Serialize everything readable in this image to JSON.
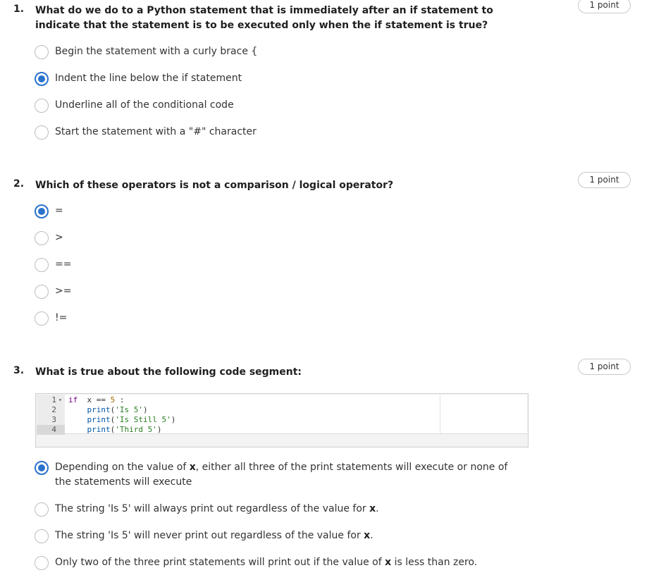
{
  "questions": [
    {
      "number": "1.",
      "text": "What do we do to a Python statement that is immediately after an if statement to indicate that the statement is to be executed only when the if statement is true?",
      "points": "1 point",
      "options": [
        {
          "label": "Begin the statement with a curly brace {",
          "checked": false
        },
        {
          "label": "Indent the line below the if statement",
          "checked": true
        },
        {
          "label": "Underline all of the conditional code",
          "checked": false
        },
        {
          "label": "Start the statement with a \"#\" character",
          "checked": false
        }
      ]
    },
    {
      "number": "2.",
      "text": "Which of these operators is not a comparison / logical operator?",
      "points": "1 point",
      "options": [
        {
          "label": "=",
          "checked": true
        },
        {
          "label": ">",
          "checked": false
        },
        {
          "label": "==",
          "checked": false
        },
        {
          "label": ">=",
          "checked": false
        },
        {
          "label": "!=",
          "checked": false
        }
      ]
    },
    {
      "number": "3.",
      "text": "What is true about the following code segment:",
      "points": "1 point",
      "code": {
        "line_numbers": [
          "1",
          "2",
          "3",
          "4"
        ],
        "fold_marker": "▾",
        "line1": {
          "kw": "if",
          "var": "x",
          "op": "==",
          "num": "5",
          "colon": ":"
        },
        "line2": {
          "fn": "print",
          "open": "(",
          "str": "'Is 5'",
          "close": ")"
        },
        "line3": {
          "fn": "print",
          "open": "(",
          "str": "'Is Still 5'",
          "close": ")"
        },
        "line4": {
          "fn": "print",
          "open": "(",
          "str": "'Third 5'",
          "close": ")"
        }
      },
      "options": [
        {
          "pre": "Depending on the value of ",
          "bold": "x",
          "post": ", either all three of the print statements will execute or none of the statements will execute",
          "checked": true
        },
        {
          "pre": "The string 'Is 5' will always print out regardless of the value for ",
          "bold": "x",
          "post": ".",
          "checked": false
        },
        {
          "pre": "The string 'Is 5' will never print out regardless of the value for ",
          "bold": "x",
          "post": ".",
          "checked": false
        },
        {
          "pre": "Only two of the three print statements will print out if the value of ",
          "bold": "x",
          "post": " is less than zero.",
          "checked": false
        }
      ]
    }
  ],
  "colors": {
    "accent": "#2a73cc",
    "text": "#1f1f1f",
    "border": "#c9c9c9"
  }
}
